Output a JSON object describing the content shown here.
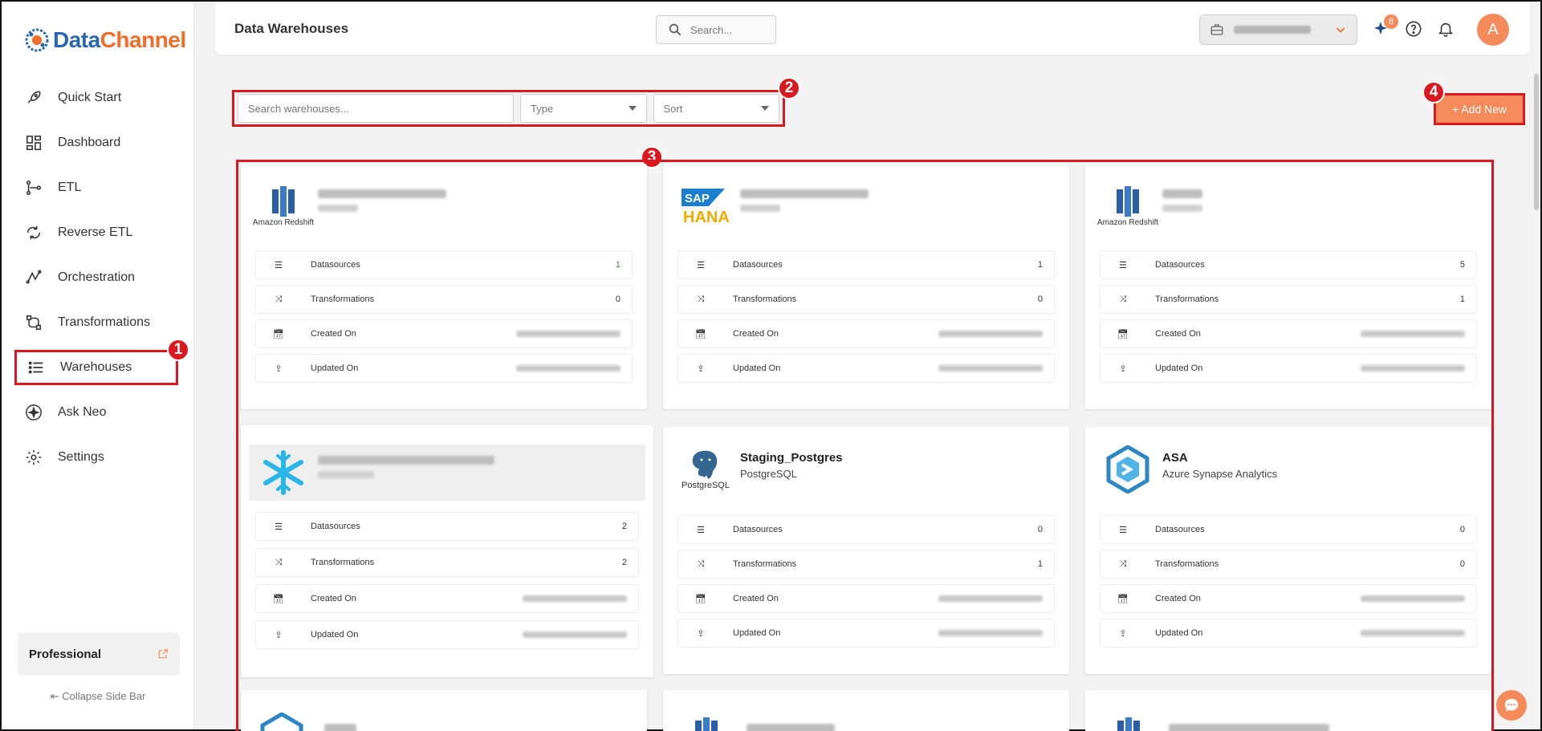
{
  "app": {
    "logo_part1": "Data",
    "logo_part2": "Channel"
  },
  "sidebar": {
    "items": [
      {
        "label": "Quick Start",
        "icon": "rocket-icon"
      },
      {
        "label": "Dashboard",
        "icon": "dashboard-icon"
      },
      {
        "label": "ETL",
        "icon": "etl-icon"
      },
      {
        "label": "Reverse ETL",
        "icon": "reverse-etl-icon"
      },
      {
        "label": "Orchestration",
        "icon": "orchestration-icon"
      },
      {
        "label": "Transformations",
        "icon": "transformations-icon"
      },
      {
        "label": "Warehouses",
        "icon": "warehouse-icon",
        "active": true
      },
      {
        "label": "Ask Neo",
        "icon": "sparkle-icon"
      },
      {
        "label": "Settings",
        "icon": "gear-icon"
      }
    ],
    "plan": "Professional",
    "collapse": "Collapse Side Bar"
  },
  "header": {
    "title": "Data Warehouses",
    "search_placeholder": "Search...",
    "notification_count": "8",
    "avatar_initial": "A"
  },
  "filters": {
    "search_placeholder": "Search warehouses...",
    "type_label": "Type",
    "sort_label": "Sort"
  },
  "actions": {
    "add_new": "+ Add New"
  },
  "markers": [
    "1",
    "2",
    "3",
    "4"
  ],
  "row_labels": {
    "datasources": "Datasources",
    "transformations": "Transformations",
    "created": "Created On",
    "updated": "Updated On"
  },
  "cards": [
    {
      "logo": "Amazon Redshift",
      "title": "",
      "subtitle": "",
      "datasources": "1",
      "transformations": "0"
    },
    {
      "logo": "SAP HANA",
      "title": "",
      "subtitle": "",
      "datasources": "1",
      "transformations": "0"
    },
    {
      "logo": "Amazon Redshift",
      "title": "",
      "subtitle": "",
      "datasources": "5",
      "transformations": "1"
    },
    {
      "logo": "Snowflake",
      "title": "",
      "subtitle": "",
      "datasources": "2",
      "transformations": "2"
    },
    {
      "logo": "PostgreSQL",
      "title": "Staging_Postgres",
      "subtitle": "PostgreSQL",
      "datasources": "0",
      "transformations": "1"
    },
    {
      "logo": "Azure Synapse",
      "title": "ASA",
      "subtitle": "Azure Synapse Analytics",
      "datasources": "0",
      "transformations": "0"
    }
  ],
  "colors": {
    "accent": "#f58a5a",
    "highlight": "#d9181f",
    "brand_blue": "#2b66b3"
  }
}
